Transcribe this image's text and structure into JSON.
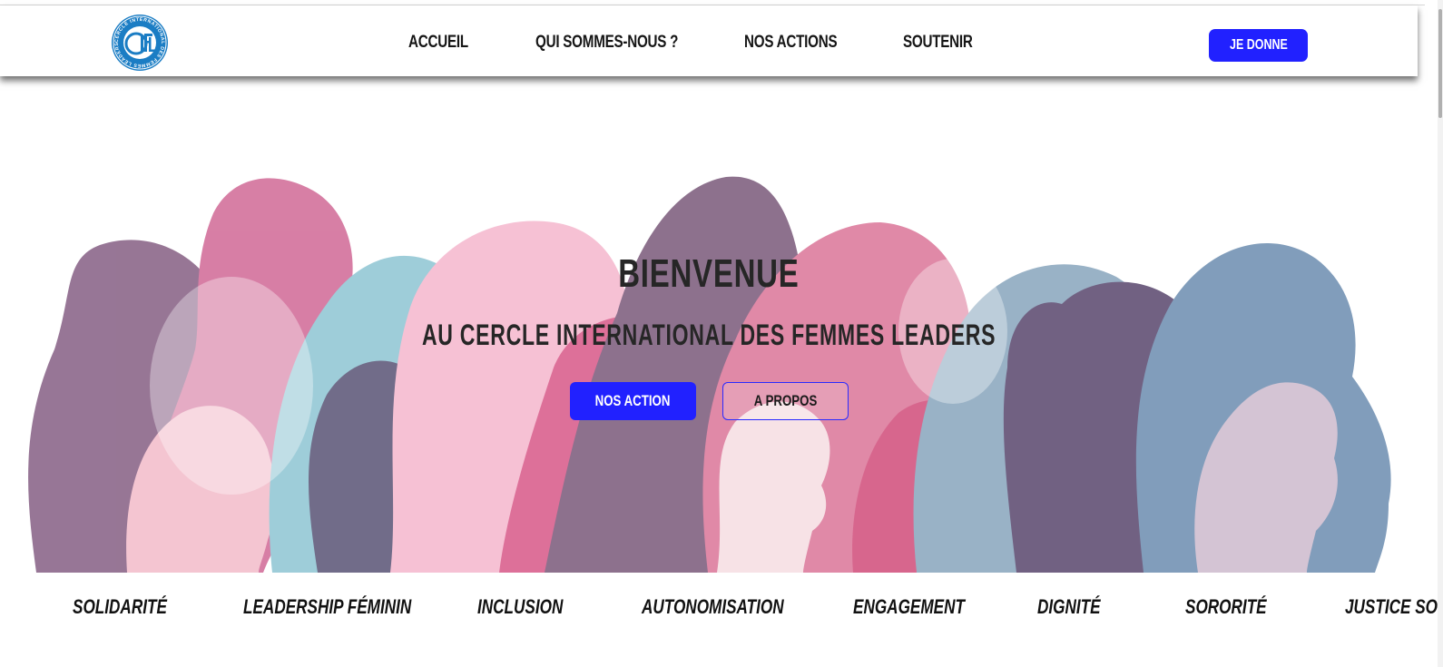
{
  "header": {
    "logo": {
      "ring_text": "CERCLE INTERNATIONAL DES FEMMES LEADERS",
      "monogram": "CIFL"
    },
    "nav": [
      {
        "label": "ACCUEIL"
      },
      {
        "label": "QUI SOMMES-NOUS ?"
      },
      {
        "label": "NOS ACTIONS"
      },
      {
        "label": "SOUTENIR"
      }
    ],
    "donate_label": "JE DONNE"
  },
  "hero": {
    "title": "BIENVENUE",
    "subtitle": "AU CERCLE INTERNATIONAL DES FEMMES LEADERS",
    "primary_button": "NOS ACTION",
    "secondary_button": "A PROPOS"
  },
  "values": [
    "SOLIDARITÉ",
    "LEADERSHIP FÉMININ",
    "INCLUSION",
    "AUTONOMISATION",
    "ENGAGEMENT",
    "DIGNITÉ",
    "SORORITÉ",
    "JUSTICE SOCIALE"
  ],
  "colors": {
    "accent": "#2121ff",
    "text": "#262626"
  }
}
